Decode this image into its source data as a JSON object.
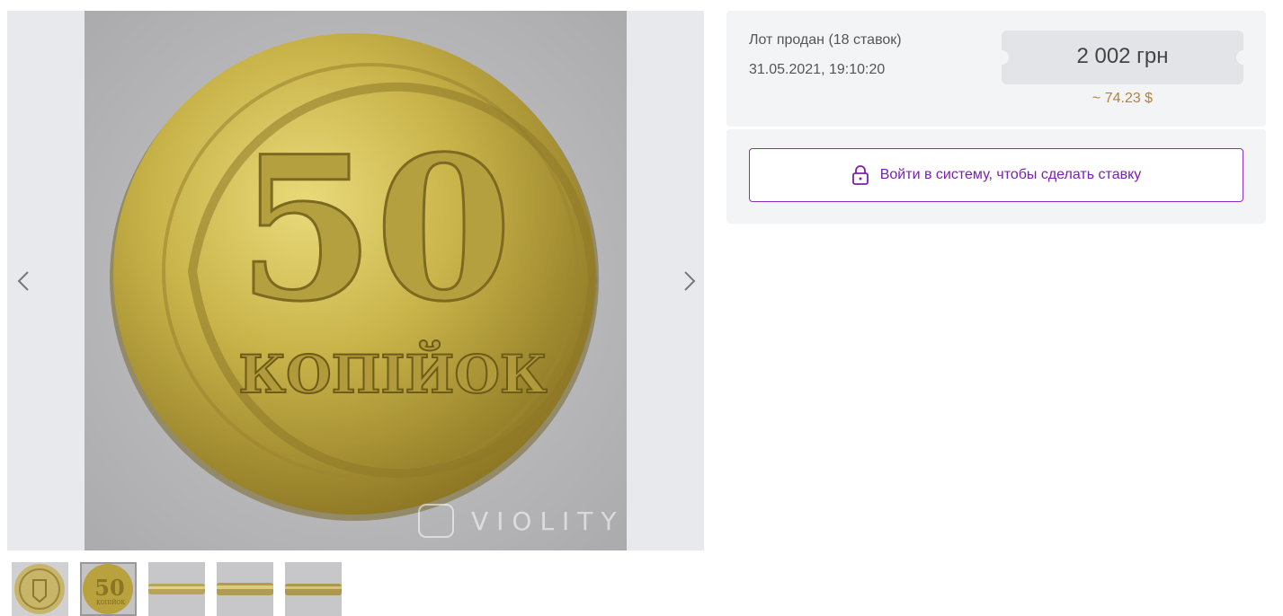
{
  "gallery": {
    "main_image": {
      "coin_text": "50",
      "coin_word": "КОПІЙОК",
      "watermark": "VIOLITY"
    },
    "prev_icon": "chevron-left-icon",
    "next_icon": "chevron-right-icon",
    "thumbnails": [
      {
        "name": "thumbnail-coin-obverse",
        "active": false
      },
      {
        "name": "thumbnail-coin-reverse",
        "active": true
      },
      {
        "name": "thumbnail-coin-edge-1",
        "active": false
      },
      {
        "name": "thumbnail-coin-edge-2",
        "active": false
      },
      {
        "name": "thumbnail-coin-edge-3",
        "active": false
      }
    ]
  },
  "lot": {
    "status": "Лот продан (18 ставок)",
    "date": "31.05.2021, 19:10:20",
    "price": "2 002 грн",
    "price_usd": "~ 74.23 $"
  },
  "bid": {
    "login_label": "Войти в систему, чтобы сделать ставку",
    "icon": "lock-icon"
  },
  "colors": {
    "accent": "#8a2bc2",
    "usd": "#b0853c",
    "panel_bg": "#f3f4f5"
  }
}
